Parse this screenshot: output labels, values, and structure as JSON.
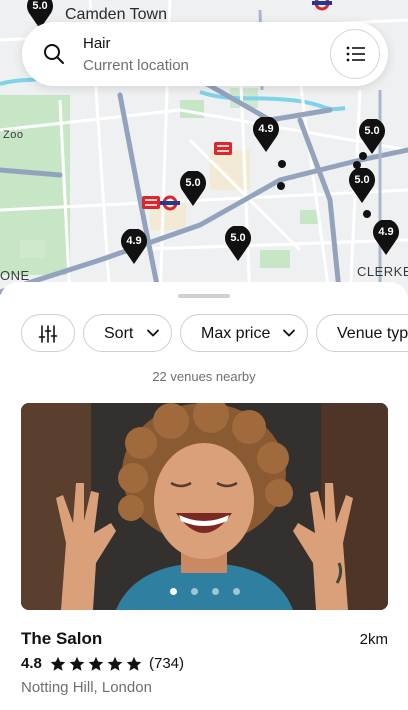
{
  "map": {
    "labels": {
      "camden_town": "Camden Town",
      "zoo": "Zoo",
      "one": "ONE",
      "clerkenwell": "CLERKE"
    },
    "pins": [
      "5.0",
      "4.9",
      "5.0",
      "5.0",
      "5.0",
      "4.9",
      "5.0",
      "4.9"
    ],
    "icons": [
      "rail-icon",
      "underground-icon"
    ]
  },
  "search": {
    "query": "Hair",
    "location": "Current location",
    "icon": "search-icon",
    "list_view_icon": "list-icon"
  },
  "filters": {
    "filters_icon": "sliders-icon",
    "sort_label": "Sort",
    "max_price_label": "Max price",
    "venue_type_label": "Venue typ"
  },
  "results": {
    "count_text": "22 venues nearby"
  },
  "venue": {
    "name": "The Salon",
    "distance": "2km",
    "rating": "4.8",
    "stars": 5,
    "reviews": "(734)",
    "location": "Notting Hill, London",
    "photo_count": 4,
    "active_photo": 1
  },
  "colors": {
    "pin": "#111111",
    "accent_red": "#d9272e",
    "map_bg": "#eef0f2",
    "road": "#93a3bd",
    "park": "#bfe3c2"
  }
}
